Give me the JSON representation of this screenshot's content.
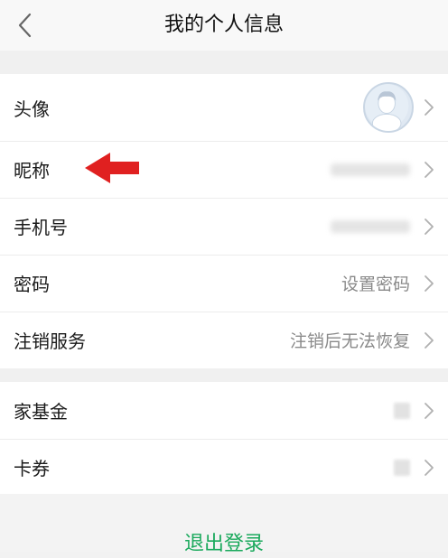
{
  "header": {
    "title": "我的个人信息"
  },
  "rows_main": [
    {
      "label": "头像",
      "value": ""
    },
    {
      "label": "昵称",
      "value": ""
    },
    {
      "label": "手机号",
      "value": ""
    },
    {
      "label": "密码",
      "value": "设置密码"
    },
    {
      "label": "注销服务",
      "value": "注销后无法恢复"
    }
  ],
  "rows_extra": [
    {
      "label": "家基金",
      "value": ""
    },
    {
      "label": "卡券",
      "value": ""
    }
  ],
  "logout_label": "退出登录",
  "colors": {
    "accent": "#1aa95c",
    "annotation_arrow": "#e02020"
  },
  "icons": {
    "back": "chevron-left-icon",
    "row": "chevron-right-icon",
    "annotation": "red-arrow-icon"
  }
}
